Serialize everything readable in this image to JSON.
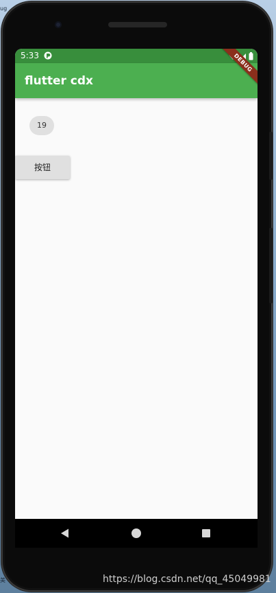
{
  "desktop": {
    "edge_text_top": "ug",
    "edge_text_bottom": "美"
  },
  "status_bar": {
    "time": "5:33",
    "background": "#388e3c"
  },
  "app_bar": {
    "title": "flutter cdx",
    "background": "#4caf50"
  },
  "debug_banner": {
    "label": "DEBUG"
  },
  "body": {
    "chip_label": "19",
    "button_label": "按钮"
  },
  "nav_bar": {
    "back_icon": "triangle-back-icon",
    "home_icon": "circle-home-icon",
    "recents_icon": "square-recents-icon"
  },
  "watermark": {
    "text": "https://blog.csdn.net/qq_45049981"
  }
}
